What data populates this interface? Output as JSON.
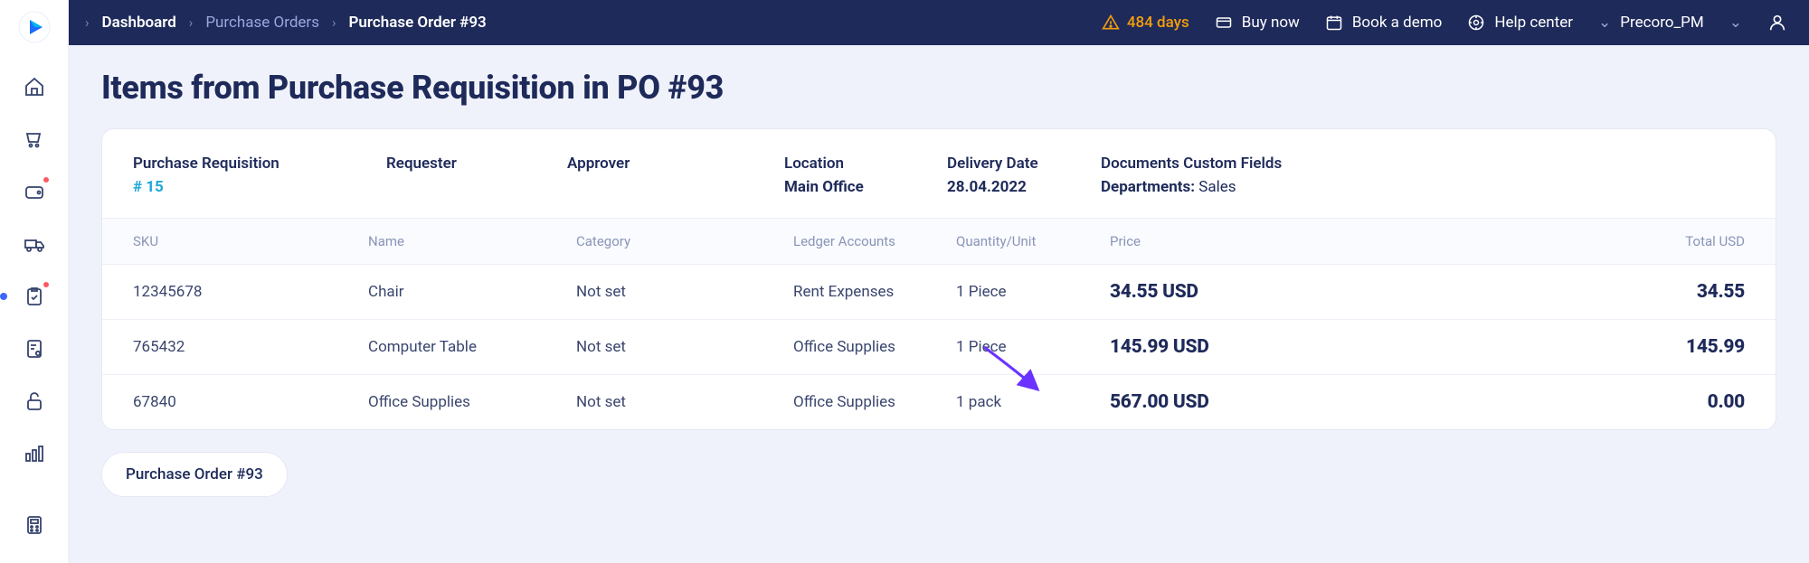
{
  "topbar": {
    "breadcrumbs": [
      "Dashboard",
      "Purchase Orders",
      "Purchase Order #93"
    ],
    "days_warning": "484 days",
    "buy_now": "Buy now",
    "book_demo": "Book a demo",
    "help_center": "Help center",
    "user_name": "Precoro_PM"
  },
  "page_title": "Items from Purchase Requisition in PO #93",
  "summary": {
    "purchase_requisition_label": "Purchase Requisition",
    "purchase_requisition_link": "# 15",
    "requester_label": "Requester",
    "approver_label": "Approver",
    "location_label": "Location",
    "location_value": "Main Office",
    "delivery_date_label": "Delivery Date",
    "delivery_date_value": "28.04.2022",
    "custom_fields_label": "Documents Custom Fields",
    "custom_field_key": "Departments:",
    "custom_field_value": "Sales"
  },
  "table": {
    "headers": {
      "sku": "SKU",
      "name": "Name",
      "category": "Category",
      "ledger": "Ledger Accounts",
      "qty": "Quantity/Unit",
      "price": "Price",
      "total": "Total USD"
    },
    "rows": [
      {
        "sku": "12345678",
        "name": "Chair",
        "category": "Not set",
        "ledger": "Rent Expenses",
        "qty": "1 Piece",
        "price": "34.55 USD",
        "total": "34.55"
      },
      {
        "sku": "765432",
        "name": "Computer Table",
        "category": "Not set",
        "ledger": "Office Supplies",
        "qty": "1 Piece",
        "price": "145.99 USD",
        "total": "145.99"
      },
      {
        "sku": "67840",
        "name": "Office Supplies",
        "category": "Not set",
        "ledger": "Office Supplies",
        "qty": "1 pack",
        "price": "567.00 USD",
        "total": "0.00"
      }
    ]
  },
  "po_chip": "Purchase Order #93"
}
